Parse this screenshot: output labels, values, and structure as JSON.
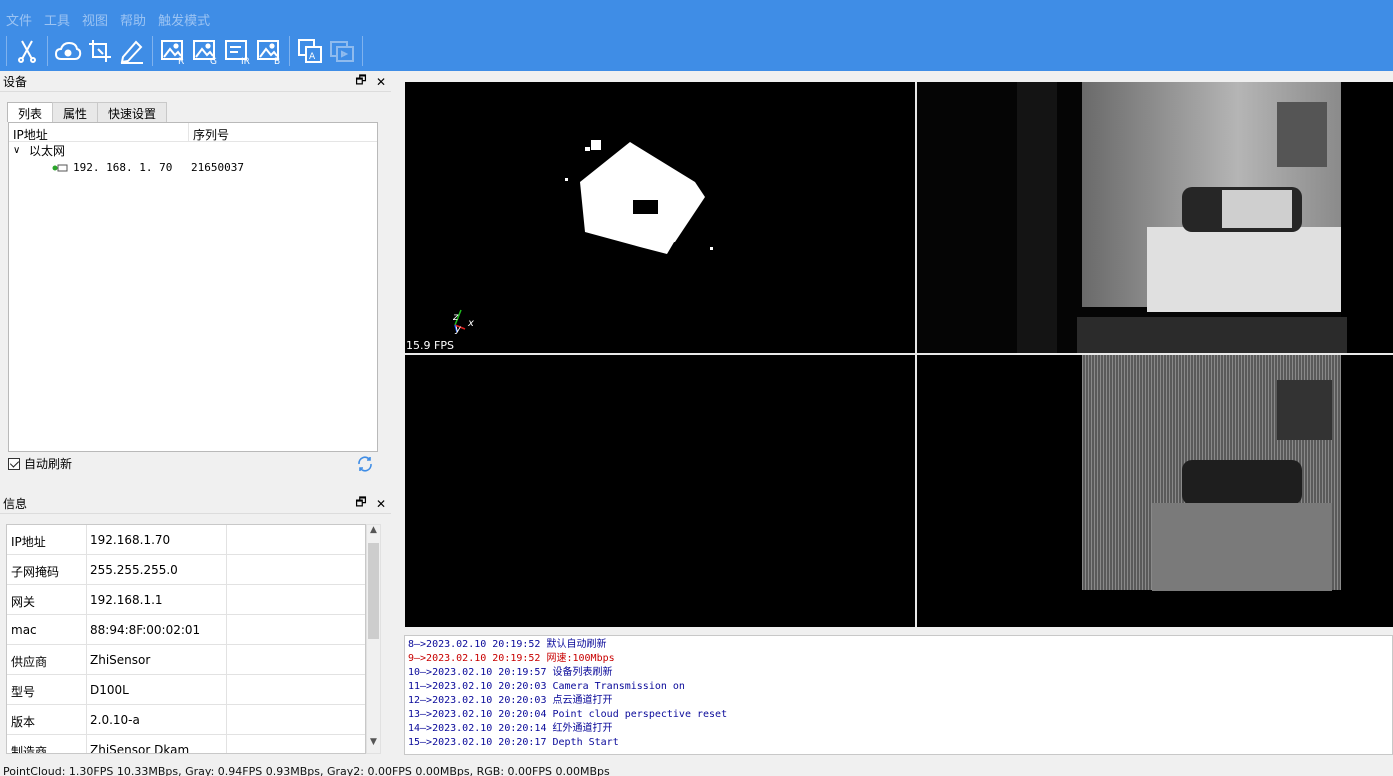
{
  "menu": [
    "文件",
    "工具",
    "视图",
    "帮助",
    "触发模式"
  ],
  "toolbar": {
    "icons": [
      "scissors-icon",
      "cloud-icon",
      "crop-icon",
      "pen-icon",
      "image-r-icon",
      "image-g-icon",
      "ir-doc-icon",
      "image-b-icon",
      "text-layer-icon",
      "layers-disabled-icon"
    ]
  },
  "device_panel": {
    "title": "设备",
    "tabs": [
      "列表",
      "属性",
      "快速设置"
    ],
    "columns": [
      "IP地址",
      "序列号"
    ],
    "group": "以太网",
    "device": {
      "ip": "192. 168. 1. 70",
      "serial": "21650037"
    },
    "auto_refresh": "自动刷新"
  },
  "info_panel": {
    "title": "信息",
    "rows": [
      {
        "key": "IP地址",
        "value": "192.168.1.70"
      },
      {
        "key": "子网掩码",
        "value": "255.255.255.0"
      },
      {
        "key": "网关",
        "value": "192.168.1.1"
      },
      {
        "key": "mac",
        "value": "88:94:8F:00:02:01"
      },
      {
        "key": "供应商",
        "value": "ZhiSensor"
      },
      {
        "key": "型号",
        "value": "D100L"
      },
      {
        "key": "版本",
        "value": "2.0.10-a"
      },
      {
        "key": "制造商",
        "value": "ZhiSensor Dkam series"
      }
    ]
  },
  "viewports": {
    "pointcloud_fps": "15.9 FPS",
    "axis_z": "z",
    "axis_y": "y",
    "axis_x": "x"
  },
  "log": [
    {
      "text": "8—>2023.02.10 20:19:52 默认自动刷新",
      "color": "blue"
    },
    {
      "text": "9—>2023.02.10 20:19:52 网速:100Mbps",
      "color": "red"
    },
    {
      "text": "10—>2023.02.10 20:19:57 设备列表刷新",
      "color": "blue"
    },
    {
      "text": "11—>2023.02.10 20:20:03 Camera Transmission on",
      "color": "blue"
    },
    {
      "text": "12—>2023.02.10 20:20:03 点云通道打开",
      "color": "blue"
    },
    {
      "text": "13—>2023.02.10 20:20:04 Point cloud perspective reset",
      "color": "blue"
    },
    {
      "text": "14—>2023.02.10 20:20:14 红外通道打开",
      "color": "blue"
    },
    {
      "text": "15—>2023.02.10 20:20:17 Depth Start",
      "color": "blue"
    }
  ],
  "status": "PointCloud: 1.30FPS 10.33MBps, Gray: 0.94FPS 0.93MBps, Gray2: 0.00FPS 0.00MBps, RGB: 0.00FPS 0.00MBps",
  "colors": {
    "topbar": "#3f8de6",
    "log_blue": "#0a0a9a",
    "log_red": "#c80000"
  }
}
